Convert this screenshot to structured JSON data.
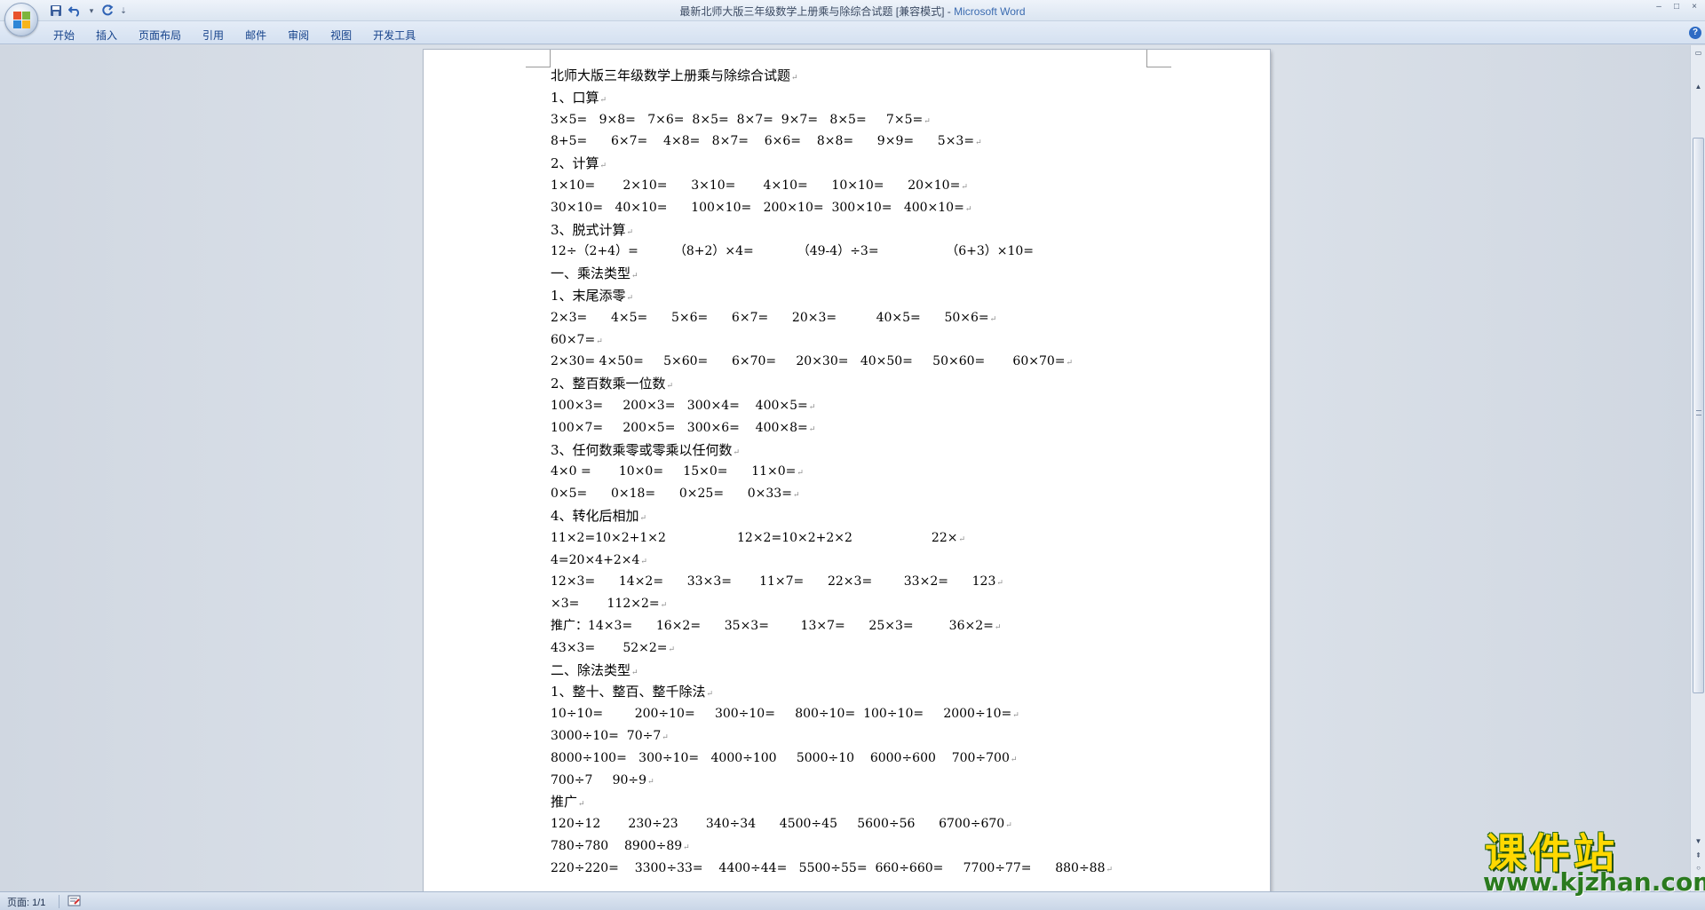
{
  "window": {
    "title": "最新北师大版三年级数学上册乘与除综合试题 [兼容模式]",
    "title_sep": " - ",
    "app_name": "Microsoft Word",
    "controls": [
      "–",
      "□",
      "×"
    ]
  },
  "quick_access": {
    "icons": [
      "save-icon",
      "undo-icon",
      "redo-icon"
    ],
    "dropdown": "▾",
    "customize": "⇣"
  },
  "ribbon": {
    "tabs": [
      "开始",
      "插入",
      "页面布局",
      "引用",
      "邮件",
      "审阅",
      "视图",
      "开发工具"
    ],
    "help": "?"
  },
  "document": {
    "paragraph_mark": "↵",
    "lines": [
      {
        "text": "北师大版三年级数学上册乘与除综合试题",
        "mark": true,
        "heading": true
      },
      {
        "text": "1、口算",
        "mark": true,
        "heading": true
      },
      {
        "text": "3×5=   9×8=   7×6=  8×5=  8×7=  9×7=   8×5=     7×5=",
        "mark": true
      },
      {
        "text": "8+5=      6×7=    4×8=   8×7=    6×6=    8×8=      9×9=      5×3=",
        "mark": true
      },
      {
        "text": "2、计算",
        "mark": true,
        "heading": true
      },
      {
        "text": "1×10=       2×10=      3×10=       4×10=      10×10=      20×10=",
        "mark": true
      },
      {
        "text": "30×10=   40×10=      100×10=   200×10=  300×10=   400×10=",
        "mark": true
      },
      {
        "text": "3、脱式计算",
        "mark": true,
        "heading": true
      },
      {
        "text": "12÷（2+4）=         （8+2）×4=           （49-4）÷3=                 （6+3）×10=",
        "mark": false
      },
      {
        "text": "一、乘法类型",
        "mark": true,
        "heading": true
      },
      {
        "text": "1、末尾添零",
        "mark": true,
        "heading": true
      },
      {
        "text": "2×3=      4×5=      5×6=      6×7=      20×3=          40×5=      50×6=",
        "mark": true
      },
      {
        "text": "60×7=",
        "mark": true
      },
      {
        "text": "2×30= 4×50=     5×60=      6×70=     20×30=   40×50=     50×60=       60×70=",
        "mark": true
      },
      {
        "text": "2、整百数乘一位数",
        "mark": true,
        "heading": true
      },
      {
        "text": "100×3=     200×3=   300×4=    400×5=",
        "mark": true
      },
      {
        "text": "100×7=     200×5=   300×6=    400×8=",
        "mark": true
      },
      {
        "text": "3、任何数乘零或零乘以任何数",
        "mark": true,
        "heading": true
      },
      {
        "text": "4×0 =       10×0=     15×0=      11×0=",
        "mark": true
      },
      {
        "text": "0×5=      0×18=      0×25=      0×33=",
        "mark": true
      },
      {
        "text": "4、转化后相加",
        "mark": true,
        "heading": true
      },
      {
        "text": "11×2=10×2+1×2                  12×2=10×2+2×2                    22×",
        "mark": true
      },
      {
        "text": "4=20×4+2×4",
        "mark": true
      },
      {
        "text": "12×3=      14×2=      33×3=       11×7=      22×3=        33×2=      123",
        "mark": true
      },
      {
        "text": "×3=       112×2=",
        "mark": true
      },
      {
        "text": "推广：14×3=      16×2=      35×3=        13×7=      25×3=         36×2=",
        "mark": true
      },
      {
        "text": "43×3=       52×2=",
        "mark": true
      },
      {
        "text": "二、除法类型",
        "mark": true,
        "heading": true
      },
      {
        "text": "1、整十、整百、整千除法",
        "mark": true,
        "heading": true
      },
      {
        "text": "10÷10=        200÷10=     300÷10=     800÷10=  100÷10=     2000÷10=",
        "mark": true
      },
      {
        "text": "3000÷10=  70÷7",
        "mark": true
      },
      {
        "text": "8000÷100=   300÷10=   4000÷100     5000÷10    6000÷600    700÷700",
        "mark": true
      },
      {
        "text": "700÷7     90÷9",
        "mark": true
      },
      {
        "text": "推广",
        "mark": true,
        "heading": true
      },
      {
        "text": "120÷12       230÷23       340÷34      4500÷45     5600÷56      6700÷670",
        "mark": true
      },
      {
        "text": "780÷780    8900÷89",
        "mark": true
      },
      {
        "text": "220÷220=    3300÷33=    4400÷44=   5500÷55=  660÷660=     7700÷77=      880÷88",
        "mark": true
      }
    ]
  },
  "statusbar": {
    "page": "页面: 1/1"
  },
  "watermark": {
    "title": "课件站",
    "url": "www.kjzhan.com"
  },
  "colors": {
    "title_app": "#3b6bb0",
    "tab_text": "#15428b",
    "watermark_yellow": "#ffd800",
    "watermark_green": "#2a7a1e"
  }
}
